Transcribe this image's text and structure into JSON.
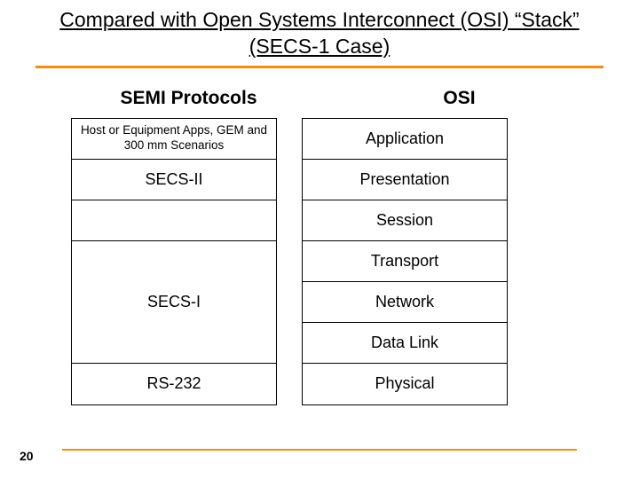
{
  "title": "Compared with Open Systems Interconnect (OSI) “Stack” (SECS-1 Case)",
  "headers": {
    "left": "SEMI Protocols",
    "right": "OSI"
  },
  "semi": {
    "row1": "Host or Equipment Apps, GEM and 300 mm Scenarios",
    "row2": "SECS-II",
    "row3": "SECS-I",
    "row4": "RS-232"
  },
  "osi": {
    "l7": "Application",
    "l6": "Presentation",
    "l5": "Session",
    "l4": "Transport",
    "l3": "Network",
    "l2": "Data Link",
    "l1": "Physical"
  },
  "page_number": "20"
}
